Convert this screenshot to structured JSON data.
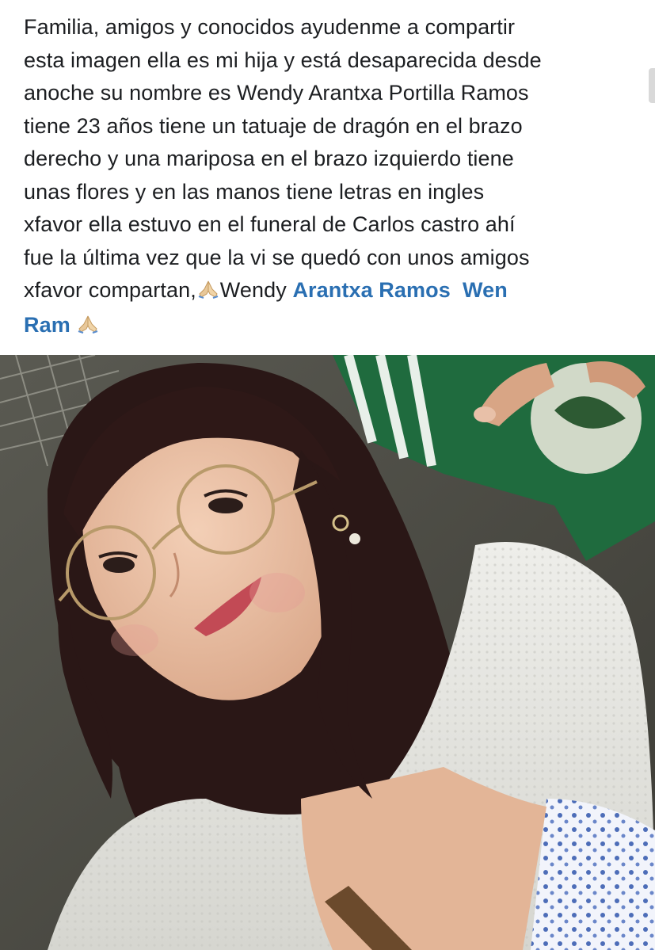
{
  "post": {
    "lines": [
      "Familia, amigos  y conocidos ayudenme  a compartir",
      "esta imagen ella es mi hija y está desaparecida desde",
      "anoche su nombre es Wendy Arantxa Portilla Ramos",
      "tiene 23 años tiene un tatuaje de dragón en el brazo",
      "derecho y una mariposa en el brazo izquierdo tiene",
      "unas flores y en las manos tiene letras en ingles",
      "xfavor ella estuvo en el funeral de Carlos castro ahí",
      "fue la última vez que la vi se quedó con unos amigos"
    ],
    "last_line_prefix": "xfavor compartan,",
    "last_line_name": "Wendy",
    "mention_1": "Arantxa Ramos",
    "mention_2_part1": "Wen",
    "mention_2_part2": "Ram",
    "mention_color": "#2a6fb2",
    "emoji_icon": "praying-hands-icon"
  },
  "photo": {
    "subject": "selfie-photo"
  }
}
